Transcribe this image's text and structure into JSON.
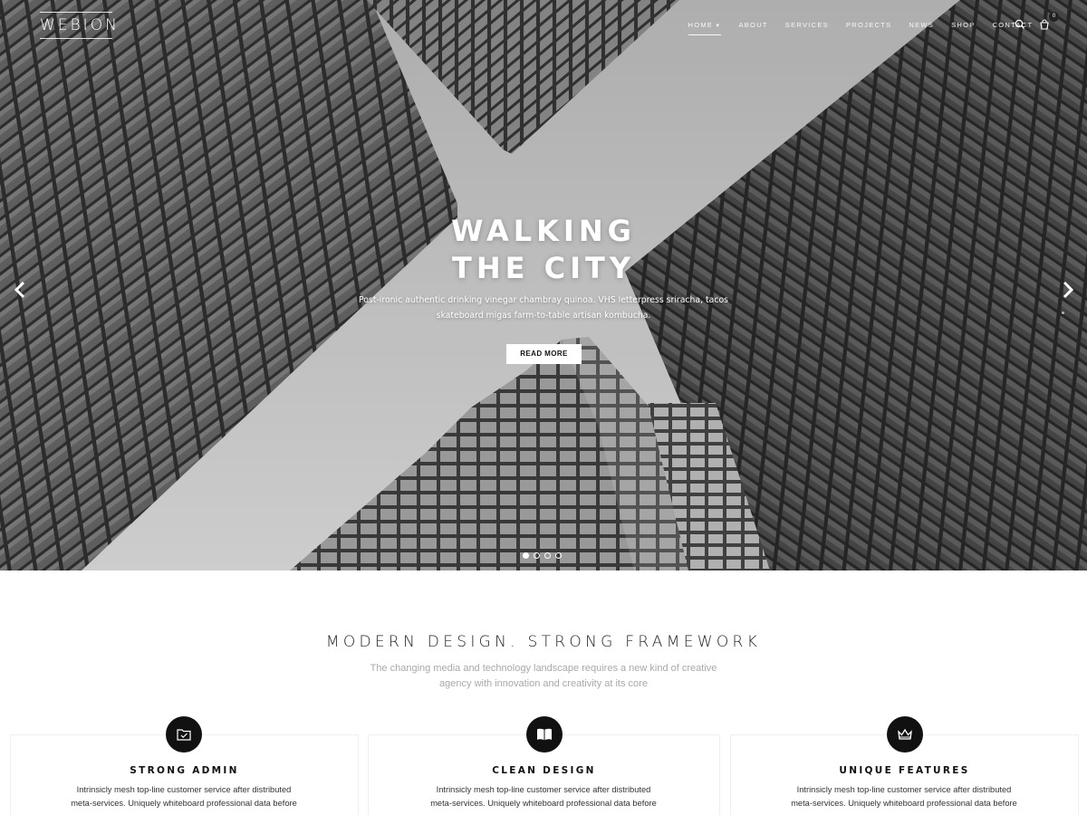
{
  "brand": {
    "logo_text": "WEBION"
  },
  "nav": {
    "items": [
      {
        "label": "HOME",
        "active": true,
        "has_caret": true
      },
      {
        "label": "ABOUT"
      },
      {
        "label": "SERVICES"
      },
      {
        "label": "PROJECTS"
      },
      {
        "label": "NEWS"
      },
      {
        "label": "SHOP"
      },
      {
        "label": "CONTACT"
      }
    ],
    "search_icon": "search-icon",
    "cart_icon": "cart-icon",
    "cart_count": "0"
  },
  "hero": {
    "title_line1": "WALKING",
    "title_line2": "THE CITY",
    "text": "Post-ironic authentic drinking vinegar chambray quinoa. VHS letterpress sriracha, tacos skateboard migas farm-to-table artisan kombucha.",
    "button_label": "READ MORE",
    "prev_icon": "chevron-left-icon",
    "next_icon": "chevron-right-icon",
    "slides_total": 4,
    "active_slide": 1
  },
  "features": {
    "title": "MODERN DESIGN. STRONG FRAMEWORK",
    "subtitle": "The changing media and technology landscape requires a new kind of creative agency with innovation and creativity at its core",
    "cards": [
      {
        "icon": "folder-check-icon",
        "title": "STRONG ADMIN",
        "text": "Intrinsicly mesh top-line customer service after distributed meta-services. Uniquely whiteboard professional data before"
      },
      {
        "icon": "open-book-icon",
        "title": "CLEAN DESIGN",
        "text": "Intrinsicly mesh top-line customer service after distributed meta-services. Uniquely whiteboard professional data before"
      },
      {
        "icon": "crown-icon",
        "title": "UNIQUE FEATURES",
        "text": "Intrinsicly mesh top-line customer service after distributed meta-services. Uniquely whiteboard professional data before"
      }
    ]
  },
  "colors": {
    "accent": "#111111",
    "muted_text": "#a8a8a8",
    "hero_overlay": "#cfcfcf"
  }
}
